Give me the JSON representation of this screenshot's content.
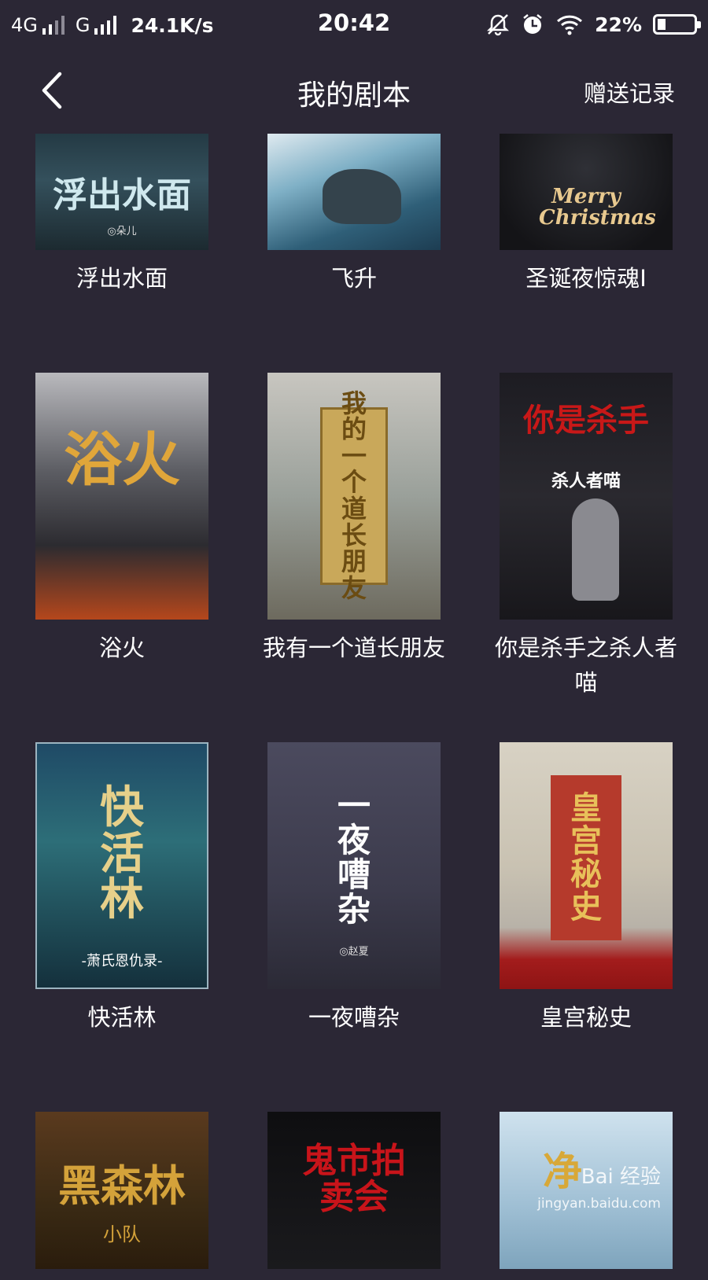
{
  "status_bar": {
    "network_4g": "4G",
    "network_g": "G",
    "speed": "24.1K/s",
    "time": "20:42",
    "battery_percent": "22%",
    "battery_level": 0.22,
    "icons": [
      "mute-bell-icon",
      "alarm-clock-icon",
      "wifi-icon",
      "battery-icon"
    ]
  },
  "nav": {
    "title": "我的剧本",
    "right_action": "赠送记录",
    "back_icon": "chevron-left-icon"
  },
  "scripts": [
    {
      "title": "浮出水面",
      "cover_text": "浮出水面",
      "cover_sub": "◎朵儿"
    },
    {
      "title": "飞升",
      "cover_text": "",
      "cover_sub": ""
    },
    {
      "title": "圣诞夜惊魂I",
      "cover_text": "Merry Christmas",
      "cover_sub": ""
    },
    {
      "title": "浴火",
      "cover_text": "浴火",
      "cover_sub": ""
    },
    {
      "title": "我有一个道长朋友",
      "cover_text": "我的一个道长朋友",
      "cover_sub": ""
    },
    {
      "title": "你是杀手之杀人者喵",
      "cover_text": "你是杀手",
      "cover_sub": "杀人者喵"
    },
    {
      "title": "快活林",
      "cover_text": "快活林",
      "cover_sub": "-萧氏恩仇录-"
    },
    {
      "title": "一夜嘈杂",
      "cover_text": "一夜嘈杂",
      "cover_sub": "◎赵夏"
    },
    {
      "title": "皇宫秘史",
      "cover_text": "皇宫秘史",
      "cover_sub": ""
    },
    {
      "title": "",
      "cover_text": "黑森林",
      "cover_sub": "小队"
    },
    {
      "title": "",
      "cover_text": "鬼市拍卖会",
      "cover_sub": ""
    },
    {
      "title": "",
      "cover_text": "净",
      "cover_sub": ""
    }
  ],
  "watermark": {
    "brand": "Bai 经验",
    "url": "jingyan.baidu.com"
  }
}
